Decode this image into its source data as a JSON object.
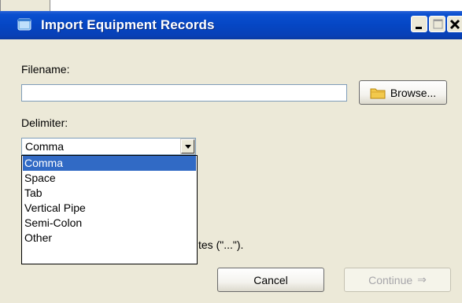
{
  "window": {
    "title": "Import Equipment Records",
    "icon": "app-window-icon"
  },
  "filename": {
    "label": "Filename:",
    "value": "",
    "browse_label": "Browse..."
  },
  "delimiter": {
    "label": "Delimiter:",
    "selected": "Comma",
    "options": [
      "Comma",
      "Space",
      "Tab",
      "Vertical Pipe",
      "Semi-Colon",
      "Other"
    ],
    "highlighted_option": "Comma"
  },
  "hidden_text": "tes (\"...\").",
  "buttons": {
    "cancel": "Cancel",
    "continue": "Continue",
    "continue_enabled": false
  },
  "colors": {
    "titlebar": "#0546c4",
    "selection": "#316ac5",
    "dialog_bg": "#ece9d8"
  }
}
